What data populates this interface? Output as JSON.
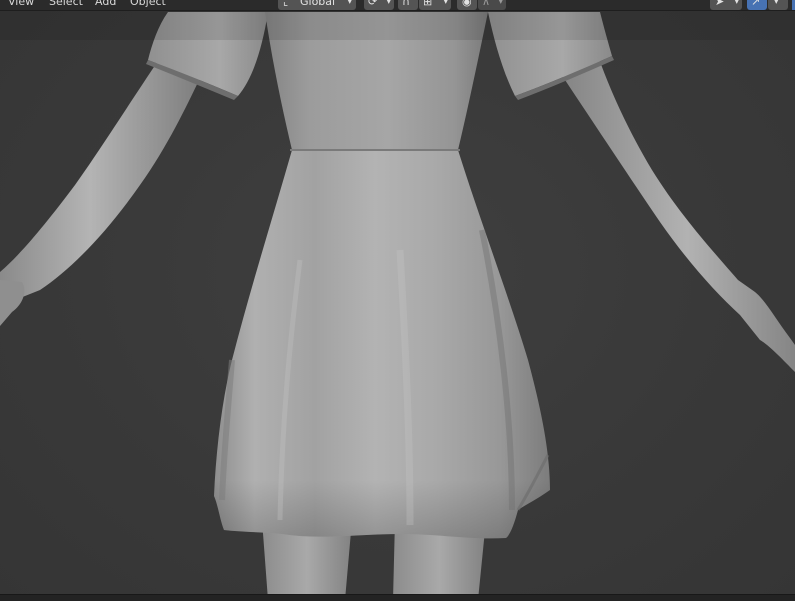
{
  "header": {
    "menus": [
      "View",
      "Select",
      "Add",
      "Object"
    ],
    "transform_orientation": "Global"
  },
  "icons": {
    "orientation": "transform-orientation-icon",
    "pivot": "pivot-point-icon",
    "snap": "snap-magnet-icon",
    "snap_target": "snap-grid-icon",
    "proportional": "proportional-edit-icon",
    "falloff": "falloff-curve-icon",
    "select_tool": "cursor-select-icon",
    "gizmo": "gizmo-toggle-icon"
  },
  "colors": {
    "viewport_bg": "#393939",
    "header_bg": "#2b2b2b",
    "mesh": "#a8a8a8",
    "accent": "#4772b3"
  }
}
